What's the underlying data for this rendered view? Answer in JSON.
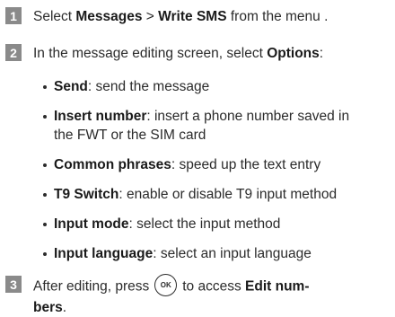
{
  "steps": [
    {
      "num": "1",
      "pre": "Select ",
      "b1": "Messages",
      "mid": " > ",
      "b2": "Write SMS",
      "post": " from the menu ."
    },
    {
      "num": "2",
      "pre": "In the message editing screen, select ",
      "b1": "Options",
      "post": ":"
    },
    {
      "num": "3",
      "pre": "After editing, press",
      "ok": "OK",
      "mid": "to access ",
      "b1": "Edit num-",
      "b2": "bers",
      "post": "."
    }
  ],
  "options": [
    {
      "term": "Send",
      "desc": ": send the message"
    },
    {
      "term": "Insert number",
      "desc": ": insert a phone number saved in",
      "desc2": "the FWT or the SIM card"
    },
    {
      "term": "Common phrases",
      "desc": ": speed up the text entry"
    },
    {
      "term": "T9 Switch",
      "desc": ": enable or disable T9 input method"
    },
    {
      "term": "Input mode",
      "desc": ": select the input method"
    },
    {
      "term": "Input language",
      "desc": ": select an input language"
    }
  ]
}
